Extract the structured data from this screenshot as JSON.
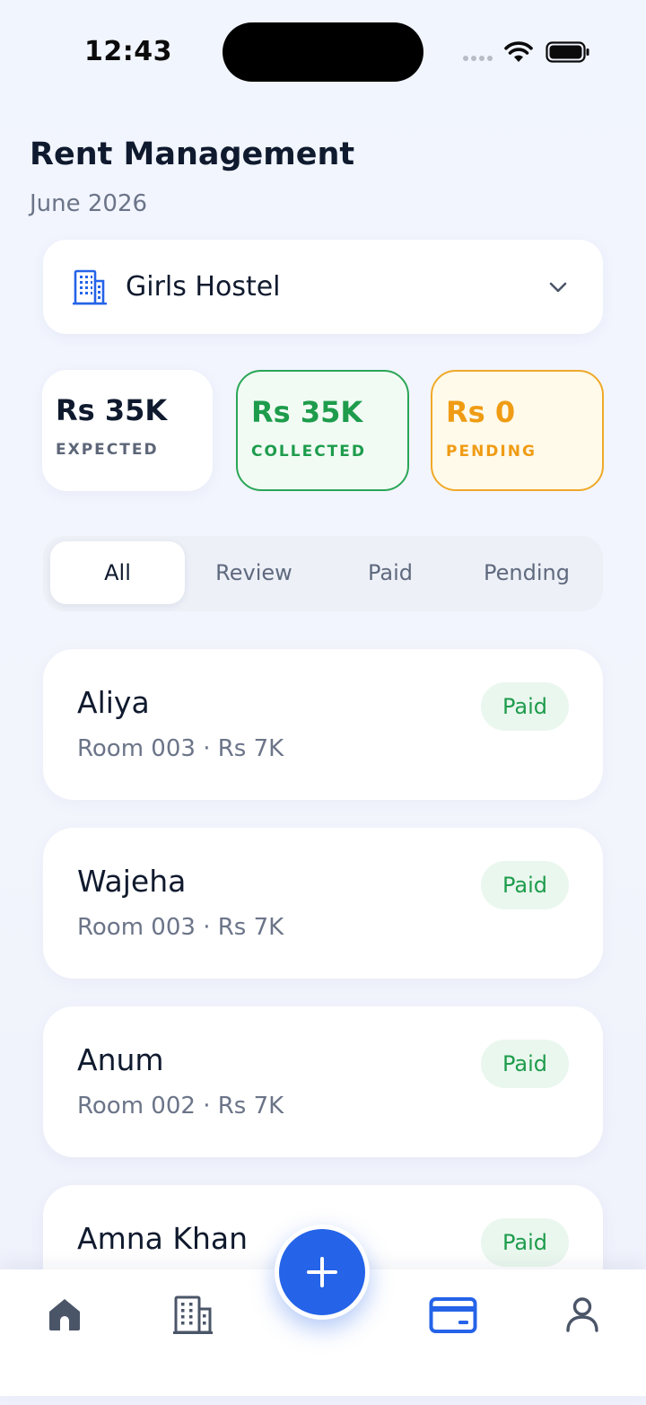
{
  "status_bar": {
    "time": "12:43"
  },
  "header": {
    "title": "Rent Management",
    "period": "June 2026"
  },
  "property_selector": {
    "selected": "Girls Hostel",
    "icon": "building-icon"
  },
  "summary": {
    "expected": {
      "value": "Rs 35K",
      "label": "EXPECTED"
    },
    "collected": {
      "value": "Rs 35K",
      "label": "COLLECTED",
      "color": "#1e9c4c"
    },
    "pending": {
      "value": "Rs 0",
      "label": "PENDING",
      "color": "#ef9c14"
    }
  },
  "filters": {
    "active": "All",
    "tabs": [
      {
        "label": "All"
      },
      {
        "label": "Review"
      },
      {
        "label": "Paid"
      },
      {
        "label": "Pending"
      }
    ]
  },
  "tenants": [
    {
      "name": "Aliya",
      "meta": "Room 003 · Rs 7K",
      "status": "Paid"
    },
    {
      "name": "Wajeha",
      "meta": "Room 003 · Rs 7K",
      "status": "Paid"
    },
    {
      "name": "Anum",
      "meta": "Room 002 · Rs 7K",
      "status": "Paid"
    },
    {
      "name": "Amna Khan",
      "meta": "",
      "status": "Paid"
    }
  ],
  "bottom_nav": {
    "items": [
      {
        "icon": "home-icon"
      },
      {
        "icon": "building-icon"
      },
      {
        "icon": "plus-icon"
      },
      {
        "icon": "credit-card-icon",
        "active": true
      },
      {
        "icon": "user-icon"
      }
    ],
    "accent": "#2563e8"
  }
}
